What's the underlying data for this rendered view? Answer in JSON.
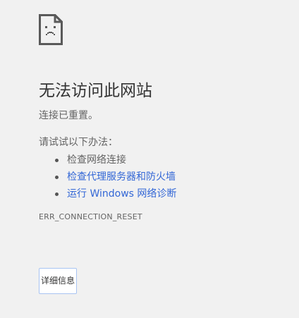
{
  "icon": "sad-page-icon",
  "title": "无法访问此网站",
  "message": "连接已重置。",
  "try_heading": "请试试以下办法：",
  "suggestions": [
    {
      "label": "检查网络连接",
      "link": false
    },
    {
      "label": "检查代理服务器和防火墙",
      "link": true
    },
    {
      "label": "运行 Windows 网络诊断",
      "link": true
    }
  ],
  "error_code": "ERR_CONNECTION_RESET",
  "details_button": "详细信息",
  "colors": {
    "background": "#f1f1f1",
    "link": "#3367d6",
    "text": "#646464",
    "title": "#333333",
    "button_border": "#a8c4f2"
  }
}
